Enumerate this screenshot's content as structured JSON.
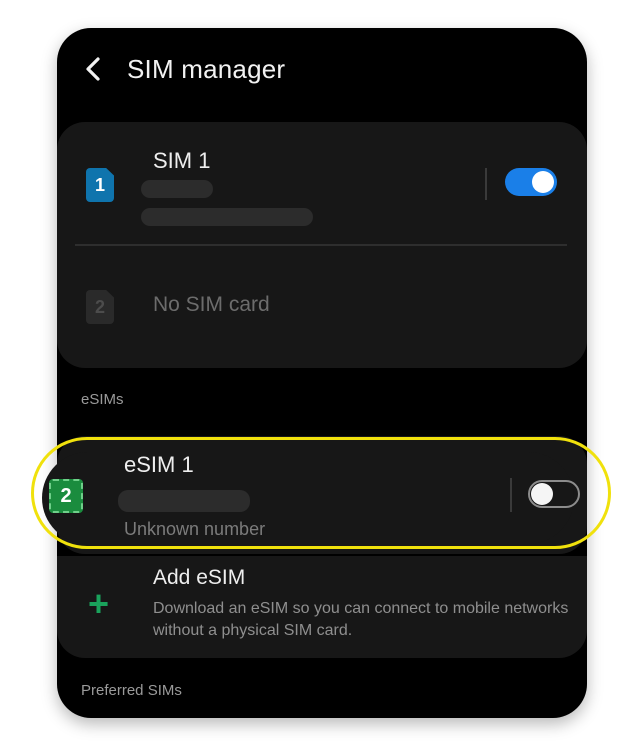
{
  "header": {
    "title": "SIM manager",
    "back_icon": "chevron-left-icon"
  },
  "sim_cards": [
    {
      "slot": "1",
      "name": "SIM 1",
      "enabled": true,
      "chip_color": "#0f74ad"
    },
    {
      "slot": "2",
      "status": "No SIM card",
      "chip_color": "#2a2a2a"
    }
  ],
  "esims_label": "eSIMs",
  "esim": {
    "slot": "2",
    "name": "eSIM 1",
    "number": "Unknown number",
    "enabled": false,
    "chip_color": "#1a8c3e"
  },
  "add_esim": {
    "title": "Add eSIM",
    "description": "Download an eSIM so you can connect to mobile networks without a physical SIM card.",
    "icon": "plus-icon",
    "icon_color": "#1aa35c"
  },
  "preferred_label": "Preferred SIMs",
  "colors": {
    "toggle_on": "#1a7fe8",
    "highlight": "#f0e10c",
    "background": "#000000"
  }
}
